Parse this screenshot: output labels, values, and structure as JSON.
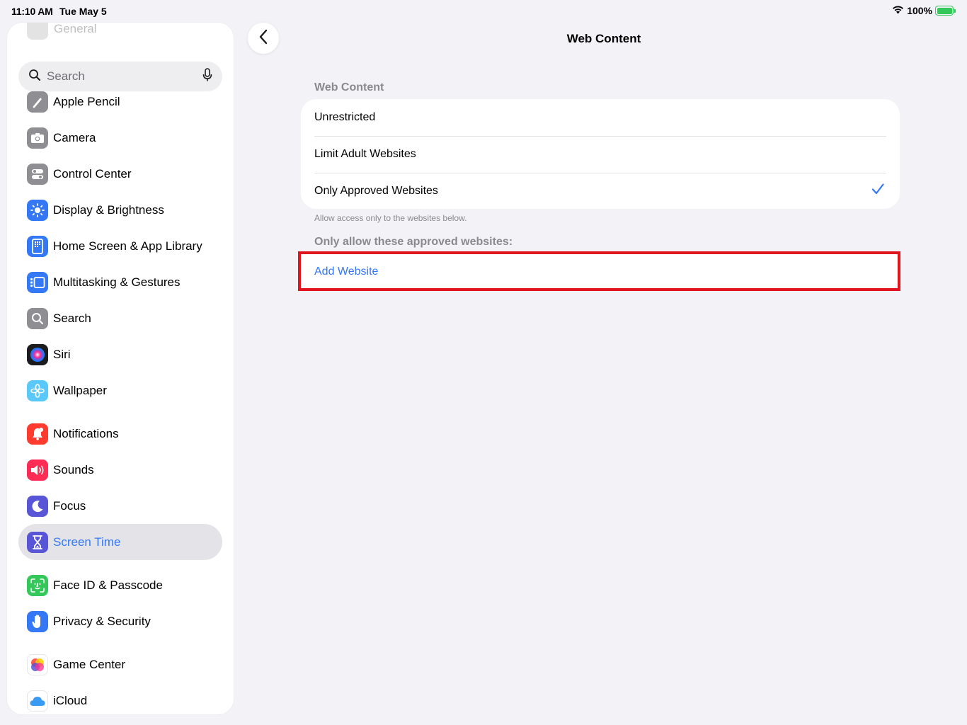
{
  "status_bar": {
    "time": "11:10 AM",
    "date": "Tue May 5",
    "battery": "100%",
    "battery_level": 1.0,
    "icons": [
      "wifi-icon",
      "battery-charging-icon"
    ]
  },
  "sidebar": {
    "faded_item": "General",
    "search": {
      "placeholder": "Search",
      "icons": [
        "magnifier-icon",
        "microphone-icon"
      ]
    },
    "items": [
      {
        "label": "Apple Pencil",
        "icon": "pencil-icon",
        "color": "#8e8e93"
      },
      {
        "label": "Camera",
        "icon": "camera-icon",
        "color": "#8e8e93"
      },
      {
        "label": "Control Center",
        "icon": "toggles-icon",
        "color": "#8e8e93"
      },
      {
        "label": "Display & Brightness",
        "icon": "sun-icon",
        "color": "#3478f6"
      },
      {
        "label": "Home Screen & App Library",
        "icon": "home-grid-icon",
        "color": "#3478f6"
      },
      {
        "label": "Multitasking & Gestures",
        "icon": "multitasking-icon",
        "color": "#3478f6"
      },
      {
        "label": "Search",
        "icon": "search-icon",
        "color": "#8e8e93"
      },
      {
        "label": "Siri",
        "icon": "siri-icon",
        "color": "#1c1c1e"
      },
      {
        "label": "Wallpaper",
        "icon": "flower-icon",
        "color": "#5ac8fa"
      },
      {
        "label": "Notifications",
        "icon": "bell-icon",
        "color": "#ff3b30"
      },
      {
        "label": "Sounds",
        "icon": "speaker-icon",
        "color": "#ff2d55"
      },
      {
        "label": "Focus",
        "icon": "moon-icon",
        "color": "#5856d6"
      },
      {
        "label": "Screen Time",
        "icon": "hourglass-icon",
        "color": "#5856d6",
        "selected": true
      },
      {
        "label": "Face ID & Passcode",
        "icon": "face-id-icon",
        "color": "#34c759"
      },
      {
        "label": "Privacy & Security",
        "icon": "hand-icon",
        "color": "#3478f6"
      },
      {
        "label": "Game Center",
        "icon": "game-center-icon",
        "color": "#ffffff"
      },
      {
        "label": "iCloud",
        "icon": "cloud-icon",
        "color": "#ffffff"
      }
    ]
  },
  "main": {
    "title": "Web Content",
    "section_header": "Web Content",
    "options": [
      {
        "label": "Unrestricted",
        "checked": false
      },
      {
        "label": "Limit Adult Websites",
        "checked": false
      },
      {
        "label": "Only Approved Websites",
        "checked": true
      }
    ],
    "footer_note": "Allow access only to the websites below.",
    "approved_header": "Only allow these approved websites:",
    "add_website": "Add Website"
  },
  "colors": {
    "accent": "#3478f6",
    "highlight": "#e0151e",
    "background": "#f2f2f7"
  }
}
